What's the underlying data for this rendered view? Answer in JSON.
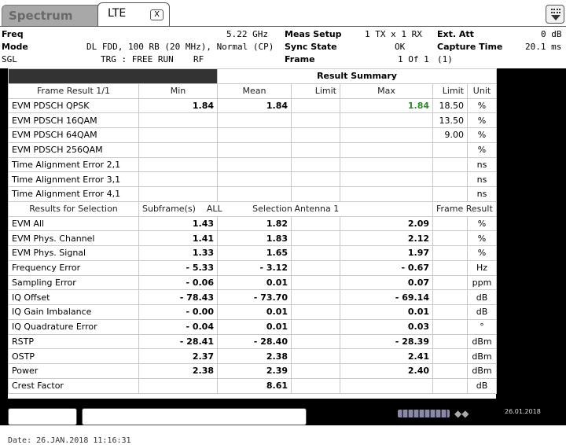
{
  "tabs": {
    "spectrum": "Spectrum",
    "lte": "LTE",
    "close_glyph": "X"
  },
  "header": {
    "freq_label": "Freq",
    "freq_value": "5.22 GHz",
    "meas_setup_label": "Meas Setup",
    "meas_setup_value": "1 TX x 1 RX",
    "ext_att_label": "Ext. Att",
    "ext_att_value": "0 dB",
    "mode_label": "Mode",
    "mode_value": "DL FDD, 100 RB (20 MHz), Normal (CP)",
    "sync_state_label": "Sync State",
    "sync_state_value": "OK",
    "capture_time_label": "Capture Time",
    "capture_time_value": "20.1 ms",
    "sgl": "SGL",
    "trg": "TRG  : FREE RUN",
    "rf": "RF",
    "frame_label": "Frame",
    "frame_value": "1 Of 1",
    "frame_extra": "(1)"
  },
  "result_summary": {
    "title": "Result Summary",
    "frame_header": [
      "Frame Result 1/1",
      "Min",
      "Mean",
      "Limit",
      "Max",
      "Limit",
      "Unit"
    ],
    "frame_rows": [
      [
        "EVM PDSCH QPSK",
        "1.84",
        "1.84",
        "",
        "1.84",
        "18.50",
        "%"
      ],
      [
        "EVM PDSCH 16QAM",
        "",
        "",
        "",
        "",
        "13.50",
        "%"
      ],
      [
        "EVM PDSCH 64QAM",
        "",
        "",
        "",
        "",
        "9.00",
        "%"
      ],
      [
        "EVM PDSCH 256QAM",
        "",
        "",
        "",
        "",
        "",
        "%"
      ],
      [
        "Time Alignment Error 2,1",
        "",
        "",
        "",
        "",
        "",
        "ns"
      ],
      [
        "Time Alignment Error 3,1",
        "",
        "",
        "",
        "",
        "",
        "ns"
      ],
      [
        "Time Alignment Error 4,1",
        "",
        "",
        "",
        "",
        "",
        "ns"
      ]
    ],
    "selection_header": {
      "label": "Results for Selection",
      "subframe_label": "Subframe(s)",
      "subframe_value": "ALL",
      "selection_label": "Selection",
      "selection_value": "Antenna 1",
      "frame_result": "Frame Result 1/1"
    },
    "selection_rows": [
      [
        "EVM All",
        "1.43",
        "1.82",
        "2.09",
        "%"
      ],
      [
        "EVM Phys. Channel",
        "1.41",
        "1.83",
        "2.12",
        "%"
      ],
      [
        "EVM Phys. Signal",
        "1.33",
        "1.65",
        "1.97",
        "%"
      ],
      [
        "Frequency Error",
        "- 5.33",
        "- 3.12",
        "- 0.67",
        "Hz"
      ],
      [
        "Sampling Error",
        "- 0.06",
        "0.01",
        "0.07",
        "ppm"
      ],
      [
        "IQ Offset",
        "- 78.43",
        "- 73.70",
        "- 69.14",
        "dB"
      ],
      [
        "IQ Gain Imbalance",
        "- 0.00",
        "0.01",
        "0.01",
        "dB"
      ],
      [
        "IQ Quadrature Error",
        "- 0.04",
        "0.01",
        "0.03",
        "°"
      ],
      [
        "RSTP",
        "- 28.41",
        "- 28.40",
        "- 28.39",
        "dBm"
      ],
      [
        "OSTP",
        "2.37",
        "2.38",
        "2.41",
        "dBm"
      ],
      [
        "Power",
        "2.38",
        "2.39",
        "2.40",
        "dBm"
      ],
      [
        "Crest Factor",
        "",
        "8.61",
        "",
        "dB"
      ]
    ]
  },
  "statusbar": {
    "date": "26.01.2018"
  },
  "footer": {
    "date_line": "Date: 26.JAN.2018  11:16:31"
  },
  "colors": {
    "pass_green": "#2a8a2a",
    "panel_black": "#000000"
  }
}
